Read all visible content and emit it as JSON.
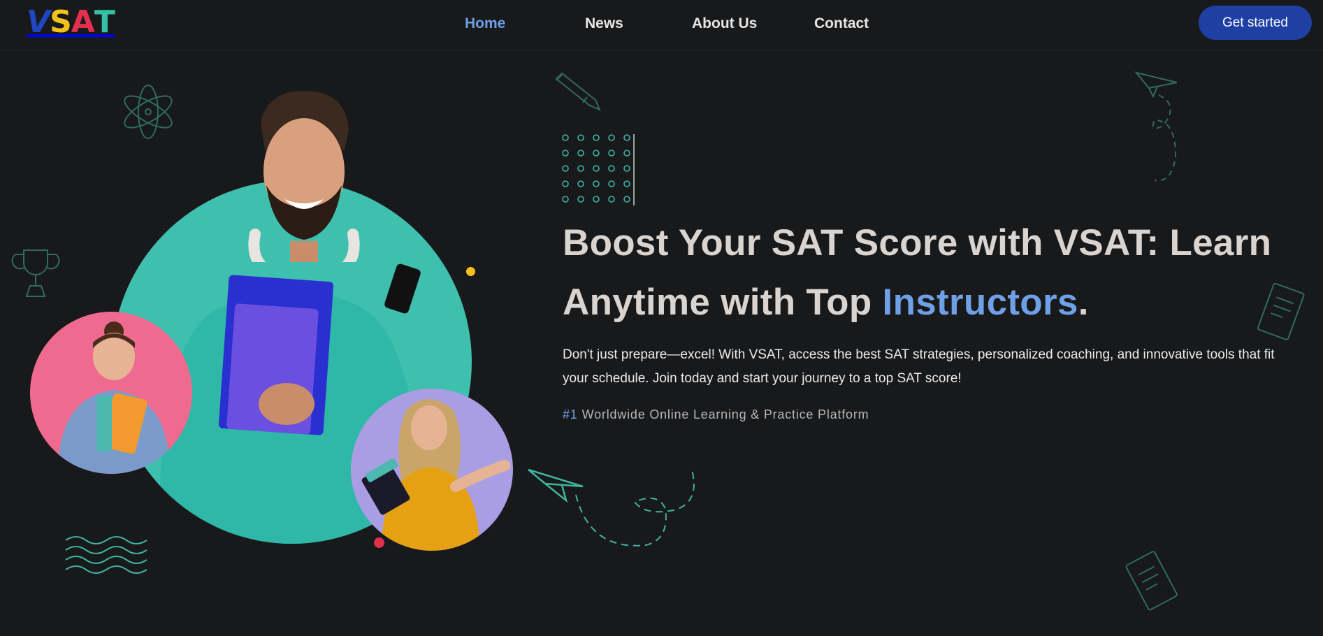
{
  "brand": {
    "logo_parts": [
      "V",
      "S",
      "A",
      "T"
    ],
    "colors": {
      "blue": "#1f47c2",
      "yellow": "#f2c21b",
      "red": "#e0304e",
      "teal": "#35c1a7"
    }
  },
  "nav": {
    "items": [
      {
        "label": "Home",
        "active": true
      },
      {
        "label": "News",
        "active": false
      },
      {
        "label": "About Us",
        "active": false
      },
      {
        "label": "Contact",
        "active": false
      }
    ],
    "cta_label": "Get started"
  },
  "hero": {
    "title_part1": "Boost Your SAT Score with VSAT: Learn Anytime with Top ",
    "title_accent": "Instructors",
    "title_end": ".",
    "description": "Don't just prepare—excel! With VSAT, access the best SAT strategies, personalized coaching, and innovative tools that fit your schedule. Join today and start your journey to a top SAT score!",
    "rank": "#1",
    "tagline": "Worldwide Online Learning & Practice Platform"
  },
  "colors": {
    "background": "#18191b",
    "accent": "#6f9fe6",
    "teal": "#45c4b0",
    "pink": "#ee6b8f",
    "lavender": "#a99de4",
    "cta": "#1e3fa3"
  },
  "icons": [
    "atom-icon",
    "trophy-icon",
    "paper-plane-icon",
    "pencil-rocket-icon",
    "document-icon",
    "wave-lines-icon",
    "dot-grid-icon"
  ]
}
